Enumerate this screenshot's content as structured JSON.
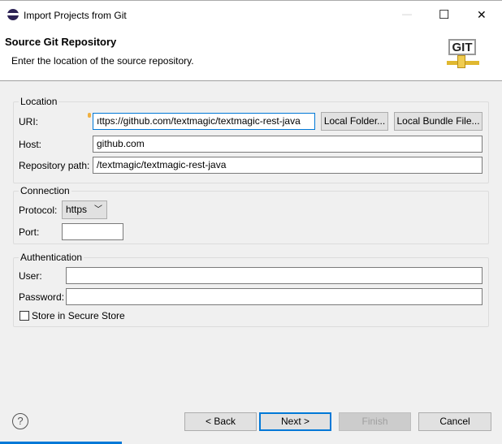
{
  "window": {
    "title": "Import Projects from Git",
    "minimize": "—",
    "maximize": "☐",
    "close": "✕"
  },
  "header": {
    "title": "Source Git Repository",
    "description": "Enter the location of the source repository.",
    "logo_text": "GIT"
  },
  "location": {
    "label": "Location",
    "uri_label": "URI:",
    "uri_value": "ıttps://github.com/textmagic/textmagic-rest-java",
    "local_folder": "Local Folder...",
    "local_bundle": "Local Bundle File...",
    "host_label": "Host:",
    "host_value": "github.com",
    "repo_label": "Repository path:",
    "repo_value": "/textmagic/textmagic-rest-java"
  },
  "connection": {
    "label": "Connection",
    "protocol_label": "Protocol:",
    "protocol_value": "https",
    "port_label": "Port:",
    "port_value": ""
  },
  "authentication": {
    "label": "Authentication",
    "user_label": "User:",
    "user_value": "",
    "password_label": "Password:",
    "password_value": "",
    "secure_store_label": "Store in Secure Store",
    "secure_store_checked": false
  },
  "footer": {
    "help": "?",
    "back": "< Back",
    "next": "Next >",
    "finish": "Finish",
    "cancel": "Cancel"
  }
}
